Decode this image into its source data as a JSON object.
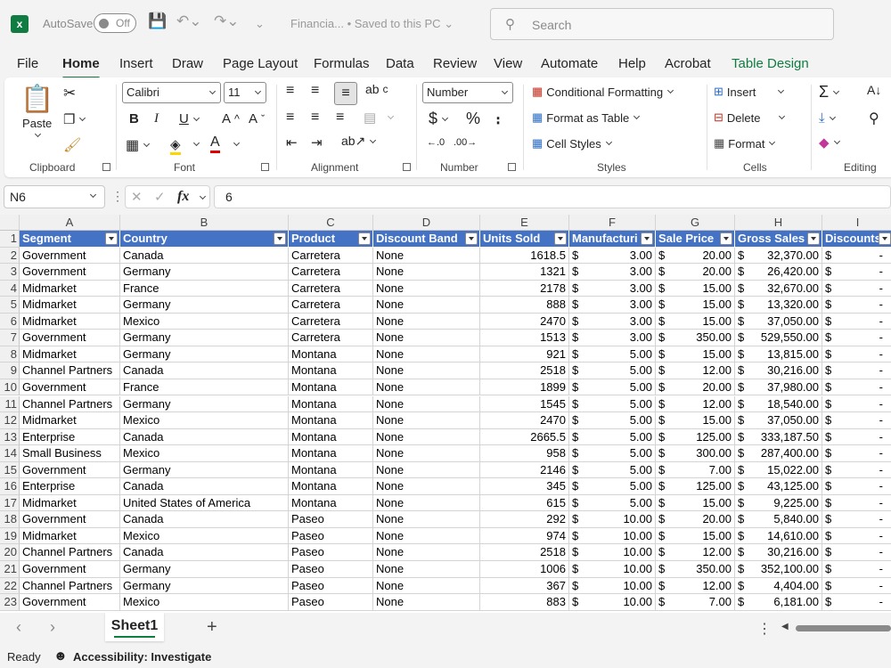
{
  "titlebar": {
    "autosave_label": "AutoSave",
    "autosave_state": "Off",
    "doc_title": "Financia... • Saved to this PC",
    "search_placeholder": "Search"
  },
  "tabs": [
    "File",
    "Home",
    "Insert",
    "Draw",
    "Page Layout",
    "Formulas",
    "Data",
    "Review",
    "View",
    "Automate",
    "Help",
    "Acrobat",
    "Table Design"
  ],
  "ribbon": {
    "clipboard": {
      "label": "Clipboard",
      "paste": "Paste"
    },
    "font": {
      "label": "Font",
      "name": "Calibri",
      "size": "11"
    },
    "alignment": {
      "label": "Alignment"
    },
    "number": {
      "label": "Number",
      "format": "Number"
    },
    "styles": {
      "label": "Styles",
      "conditional": "Conditional Formatting",
      "format_table": "Format as Table",
      "cell_styles": "Cell Styles"
    },
    "cells": {
      "label": "Cells",
      "insert": "Insert",
      "delete": "Delete",
      "format": "Format"
    },
    "editing": {
      "label": "Editing"
    }
  },
  "formula_bar": {
    "name_box": "N6",
    "formula": "6",
    "fx": "fx"
  },
  "columns": [
    "A",
    "B",
    "C",
    "D",
    "E",
    "F",
    "G",
    "H",
    "I"
  ],
  "headers": [
    "Segment",
    "Country",
    "Product",
    "Discount Band",
    "Units Sold",
    "Manufacturi",
    "Sale Price",
    "Gross Sales",
    "Discounts"
  ],
  "rows": [
    [
      "Government",
      "Canada",
      "Carretera",
      "None",
      "1618.5",
      "3.00",
      "20.00",
      "32,370.00",
      "-"
    ],
    [
      "Government",
      "Germany",
      "Carretera",
      "None",
      "1321",
      "3.00",
      "20.00",
      "26,420.00",
      "-"
    ],
    [
      "Midmarket",
      "France",
      "Carretera",
      "None",
      "2178",
      "3.00",
      "15.00",
      "32,670.00",
      "-"
    ],
    [
      "Midmarket",
      "Germany",
      "Carretera",
      "None",
      "888",
      "3.00",
      "15.00",
      "13,320.00",
      "-"
    ],
    [
      "Midmarket",
      "Mexico",
      "Carretera",
      "None",
      "2470",
      "3.00",
      "15.00",
      "37,050.00",
      "-"
    ],
    [
      "Government",
      "Germany",
      "Carretera",
      "None",
      "1513",
      "3.00",
      "350.00",
      "529,550.00",
      "-"
    ],
    [
      "Midmarket",
      "Germany",
      "Montana",
      "None",
      "921",
      "5.00",
      "15.00",
      "13,815.00",
      "-"
    ],
    [
      "Channel Partners",
      "Canada",
      "Montana",
      "None",
      "2518",
      "5.00",
      "12.00",
      "30,216.00",
      "-"
    ],
    [
      "Government",
      "France",
      "Montana",
      "None",
      "1899",
      "5.00",
      "20.00",
      "37,980.00",
      "-"
    ],
    [
      "Channel Partners",
      "Germany",
      "Montana",
      "None",
      "1545",
      "5.00",
      "12.00",
      "18,540.00",
      "-"
    ],
    [
      "Midmarket",
      "Mexico",
      "Montana",
      "None",
      "2470",
      "5.00",
      "15.00",
      "37,050.00",
      "-"
    ],
    [
      "Enterprise",
      "Canada",
      "Montana",
      "None",
      "2665.5",
      "5.00",
      "125.00",
      "333,187.50",
      "-"
    ],
    [
      "Small Business",
      "Mexico",
      "Montana",
      "None",
      "958",
      "5.00",
      "300.00",
      "287,400.00",
      "-"
    ],
    [
      "Government",
      "Germany",
      "Montana",
      "None",
      "2146",
      "5.00",
      "7.00",
      "15,022.00",
      "-"
    ],
    [
      "Enterprise",
      "Canada",
      "Montana",
      "None",
      "345",
      "5.00",
      "125.00",
      "43,125.00",
      "-"
    ],
    [
      "Midmarket",
      "United States of America",
      "Montana",
      "None",
      "615",
      "5.00",
      "15.00",
      "9,225.00",
      "-"
    ],
    [
      "Government",
      "Canada",
      "Paseo",
      "None",
      "292",
      "10.00",
      "20.00",
      "5,840.00",
      "-"
    ],
    [
      "Midmarket",
      "Mexico",
      "Paseo",
      "None",
      "974",
      "10.00",
      "15.00",
      "14,610.00",
      "-"
    ],
    [
      "Channel Partners",
      "Canada",
      "Paseo",
      "None",
      "2518",
      "10.00",
      "12.00",
      "30,216.00",
      "-"
    ],
    [
      "Government",
      "Germany",
      "Paseo",
      "None",
      "1006",
      "10.00",
      "350.00",
      "352,100.00",
      "-"
    ],
    [
      "Channel Partners",
      "Germany",
      "Paseo",
      "None",
      "367",
      "10.00",
      "12.00",
      "4,404.00",
      "-"
    ],
    [
      "Government",
      "Mexico",
      "Paseo",
      "None",
      "883",
      "10.00",
      "7.00",
      "6,181.00",
      "-"
    ]
  ],
  "currency_symbol": "$",
  "sheet_tab": "Sheet1",
  "status": {
    "ready": "Ready",
    "accessibility": "Accessibility: Investigate"
  },
  "colors": {
    "excel_green": "#107c41",
    "table_header": "#4472c4"
  }
}
